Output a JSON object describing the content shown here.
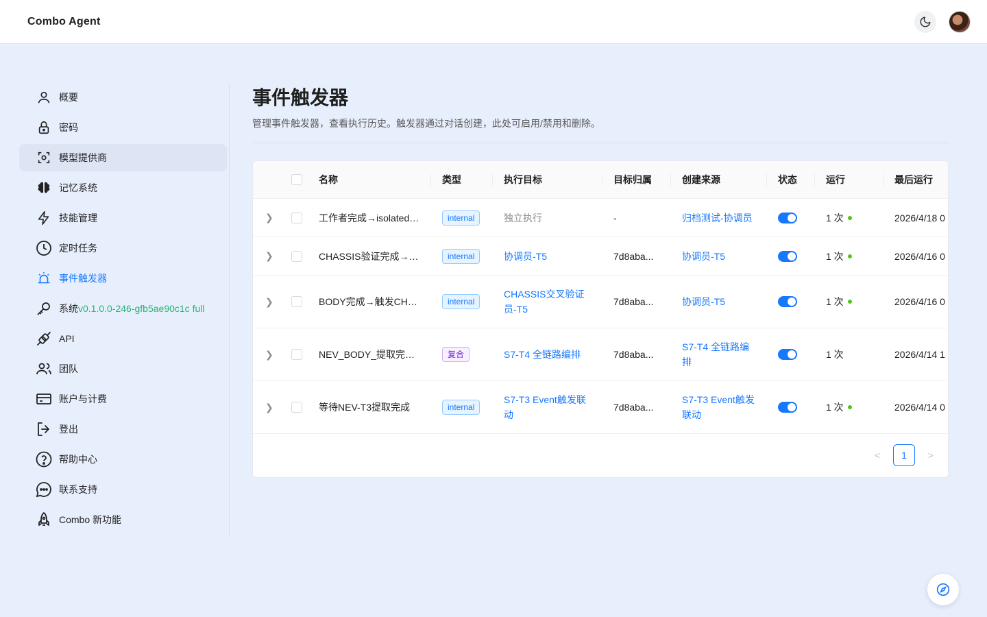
{
  "app": {
    "title": "Combo Agent"
  },
  "header": {
    "theme_icon": "moon-icon",
    "avatar_icon": "user-avatar"
  },
  "sidebar": {
    "items": [
      {
        "label": "概要",
        "icon": "user-icon"
      },
      {
        "label": "密码",
        "icon": "lock-icon"
      },
      {
        "label": "模型提供商",
        "icon": "model-icon"
      },
      {
        "label": "记忆系统",
        "icon": "brain-icon"
      },
      {
        "label": "技能管理",
        "icon": "lightning-icon"
      },
      {
        "label": "定时任务",
        "icon": "clock-icon"
      },
      {
        "label": "事件触发器",
        "icon": "alarm-icon"
      },
      {
        "label": "系统",
        "version": "v0.1.0.0-246-gfb5ae90c1c full",
        "icon": "key-icon"
      },
      {
        "label": "API",
        "icon": "plug-icon"
      },
      {
        "label": "团队",
        "icon": "team-icon"
      },
      {
        "label": "账户与计费",
        "icon": "card-icon"
      },
      {
        "label": "登出",
        "icon": "logout-icon"
      },
      {
        "label": "帮助中心",
        "icon": "help-icon"
      },
      {
        "label": "联系支持",
        "icon": "chat-icon"
      },
      {
        "label": "Combo 新功能",
        "icon": "rocket-icon"
      }
    ]
  },
  "main": {
    "title": "事件触发器",
    "description": "管理事件触发器，查看执行历史。触发器通过对话创建，此处可启用/禁用和删除。"
  },
  "table": {
    "columns": [
      "名称",
      "类型",
      "执行目标",
      "目标归属",
      "创建来源",
      "状态",
      "运行",
      "最后运行"
    ],
    "rows": [
      {
        "name": "工作者完成→isolated执行",
        "type": "internal",
        "target": "独立执行",
        "owner": "-",
        "source": "归档测试-协调员",
        "enabled": true,
        "runs": "1 次",
        "run_ok": true,
        "last": "2026/4/18 0"
      },
      {
        "name": "CHASSIS验证完成→触发",
        "type": "internal",
        "target": "协调员-T5",
        "owner": "7d8aba...",
        "source": "协调员-T5",
        "enabled": true,
        "runs": "1 次",
        "run_ok": true,
        "last": "2026/4/16 0"
      },
      {
        "name": "BODY完成→触发CHASSIS",
        "type": "internal",
        "target": "CHASSIS交叉验证员-T5",
        "owner": "7d8aba...",
        "source": "协调员-T5",
        "enabled": true,
        "runs": "1 次",
        "run_ok": true,
        "last": "2026/4/16 0"
      },
      {
        "name": "NEV_BODY_提取完成触发",
        "type": "复合",
        "target": "S7-T4 全链路编排",
        "owner": "7d8aba...",
        "source": "S7-T4 全链路编排",
        "enabled": true,
        "runs": "1 次",
        "run_ok": false,
        "last": "2026/4/14 1"
      },
      {
        "name": "等待NEV-T3提取完成",
        "type": "internal",
        "target": "S7-T3 Event触发联动",
        "owner": "7d8aba...",
        "source": "S7-T3 Event触发联动",
        "enabled": true,
        "runs": "1 次",
        "run_ok": true,
        "last": "2026/4/14 0"
      }
    ]
  },
  "pagination": {
    "current": "1"
  },
  "colors": {
    "accent": "#1677ff",
    "success": "#52c41a",
    "version": "#22b573",
    "background": "#e8effc"
  }
}
